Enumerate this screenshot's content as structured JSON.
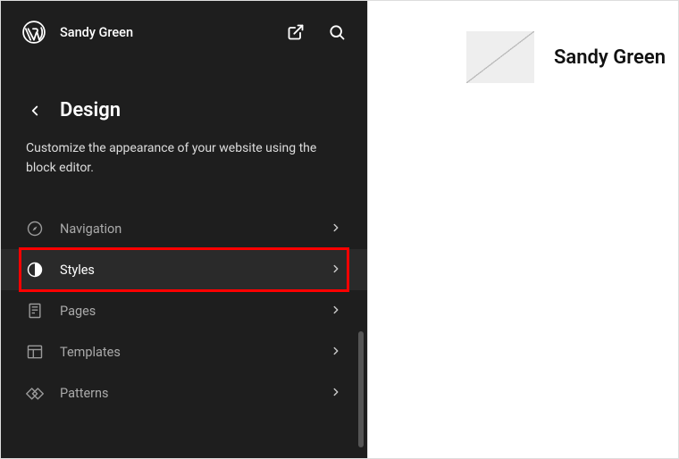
{
  "site": {
    "title": "Sandy Green"
  },
  "panel": {
    "title": "Design",
    "description": "Customize the appearance of your website using the block editor."
  },
  "menu": {
    "items": [
      {
        "label": "Navigation"
      },
      {
        "label": "Styles"
      },
      {
        "label": "Pages"
      },
      {
        "label": "Templates"
      },
      {
        "label": "Patterns"
      }
    ]
  },
  "preview": {
    "title": "Sandy Green"
  }
}
